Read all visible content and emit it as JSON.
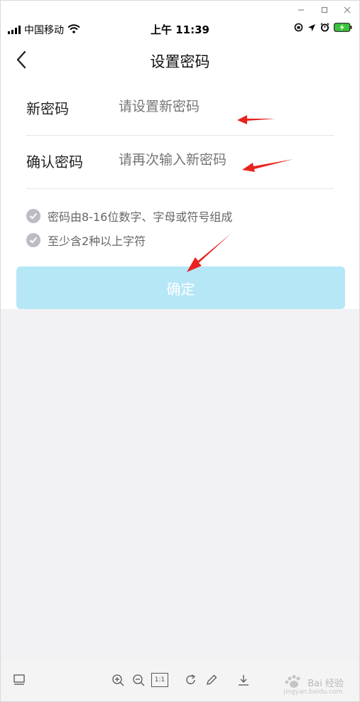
{
  "status_bar": {
    "carrier": "中国移动",
    "time": "上午 11:39"
  },
  "nav": {
    "title": "设置密码"
  },
  "form": {
    "new_password": {
      "label": "新密码",
      "placeholder": "请设置新密码"
    },
    "confirm_password": {
      "label": "确认密码",
      "placeholder": "请再次输入新密码"
    }
  },
  "rules": [
    {
      "text": "密码由8-16位数字、字母或符号组成"
    },
    {
      "text": "至少含2种以上字符"
    }
  ],
  "confirm_button": {
    "label": "确定"
  },
  "viewer_toolbar": {
    "zoom_reset_label": "1:1"
  },
  "watermark": {
    "text": "Bai 经验",
    "sub": "jingyan.baidu.com"
  },
  "colors": {
    "button_bg": "#b6e7f7",
    "annotation_arrow": "#e8231e",
    "check_bg": "#bcbcc4"
  }
}
